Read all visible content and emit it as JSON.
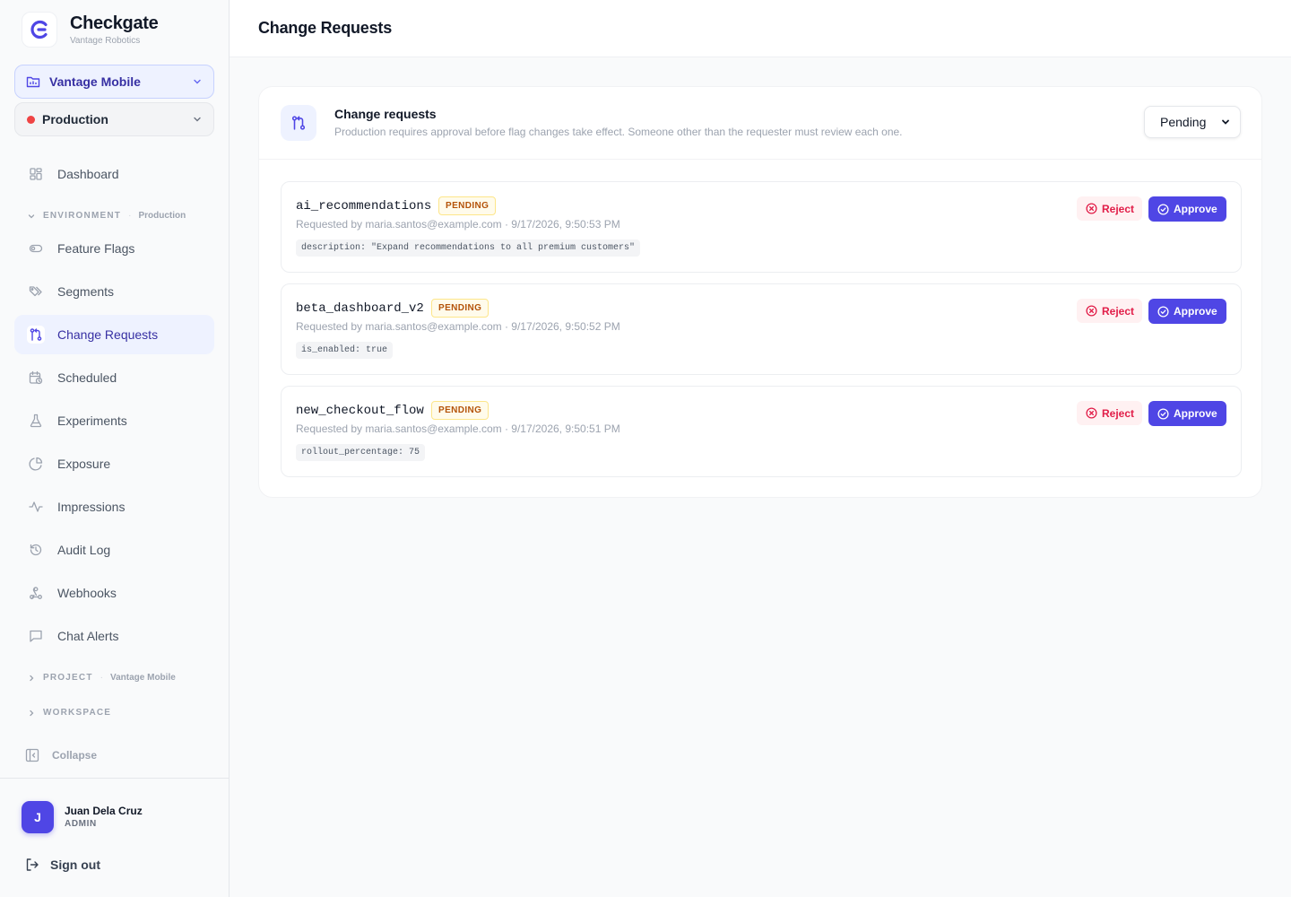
{
  "brand": {
    "name": "Checkgate",
    "org": "Vantage Robotics"
  },
  "project_picker": {
    "label": "Vantage Mobile"
  },
  "env_picker": {
    "label": "Production",
    "dot_color": "#ef4444"
  },
  "nav": {
    "dashboard": "Dashboard",
    "environment_section": {
      "title": "ENVIRONMENT",
      "context": "Production"
    },
    "env_items": [
      {
        "label": "Feature Flags",
        "icon": "toggle-icon"
      },
      {
        "label": "Segments",
        "icon": "tags-icon"
      },
      {
        "label": "Change Requests",
        "icon": "git-pull-request-icon",
        "active": true
      },
      {
        "label": "Scheduled",
        "icon": "calendar-clock-icon"
      },
      {
        "label": "Experiments",
        "icon": "flask-icon"
      },
      {
        "label": "Exposure",
        "icon": "pie-chart-icon"
      },
      {
        "label": "Impressions",
        "icon": "activity-icon"
      },
      {
        "label": "Audit Log",
        "icon": "history-icon"
      },
      {
        "label": "Webhooks",
        "icon": "webhook-icon"
      },
      {
        "label": "Chat Alerts",
        "icon": "message-square-icon"
      }
    ],
    "project_section": {
      "title": "PROJECT",
      "context": "Vantage Mobile"
    },
    "workspace_section": {
      "title": "WORKSPACE"
    },
    "collapse": "Collapse"
  },
  "user": {
    "initial": "J",
    "name": "Juan Dela Cruz",
    "role": "ADMIN",
    "signout": "Sign out"
  },
  "header": {
    "title": "Change Requests"
  },
  "panel": {
    "title": "Change requests",
    "description": "Production requires approval before flag changes take effect. Someone other than the requester must review each one.",
    "filter": {
      "selected": "Pending"
    }
  },
  "requests": [
    {
      "flag_key": "ai_recommendations",
      "status": "PENDING",
      "requested_by": "Requested by maria.santos@example.com · 9/17/2026, 9:50:53 PM",
      "change": "description: \"Expand recommendations to all premium customers\"",
      "reject_label": "Reject",
      "approve_label": "Approve"
    },
    {
      "flag_key": "beta_dashboard_v2",
      "status": "PENDING",
      "requested_by": "Requested by maria.santos@example.com · 9/17/2026, 9:50:52 PM",
      "change": "is_enabled: true",
      "reject_label": "Reject",
      "approve_label": "Approve"
    },
    {
      "flag_key": "new_checkout_flow",
      "status": "PENDING",
      "requested_by": "Requested by maria.santos@example.com · 9/17/2026, 9:50:51 PM",
      "change": "rollout_percentage: 75",
      "reject_label": "Reject",
      "approve_label": "Approve"
    }
  ],
  "colors": {
    "accent": "#4f46e5",
    "reject": "#e11d48",
    "pending": "#b45309"
  }
}
